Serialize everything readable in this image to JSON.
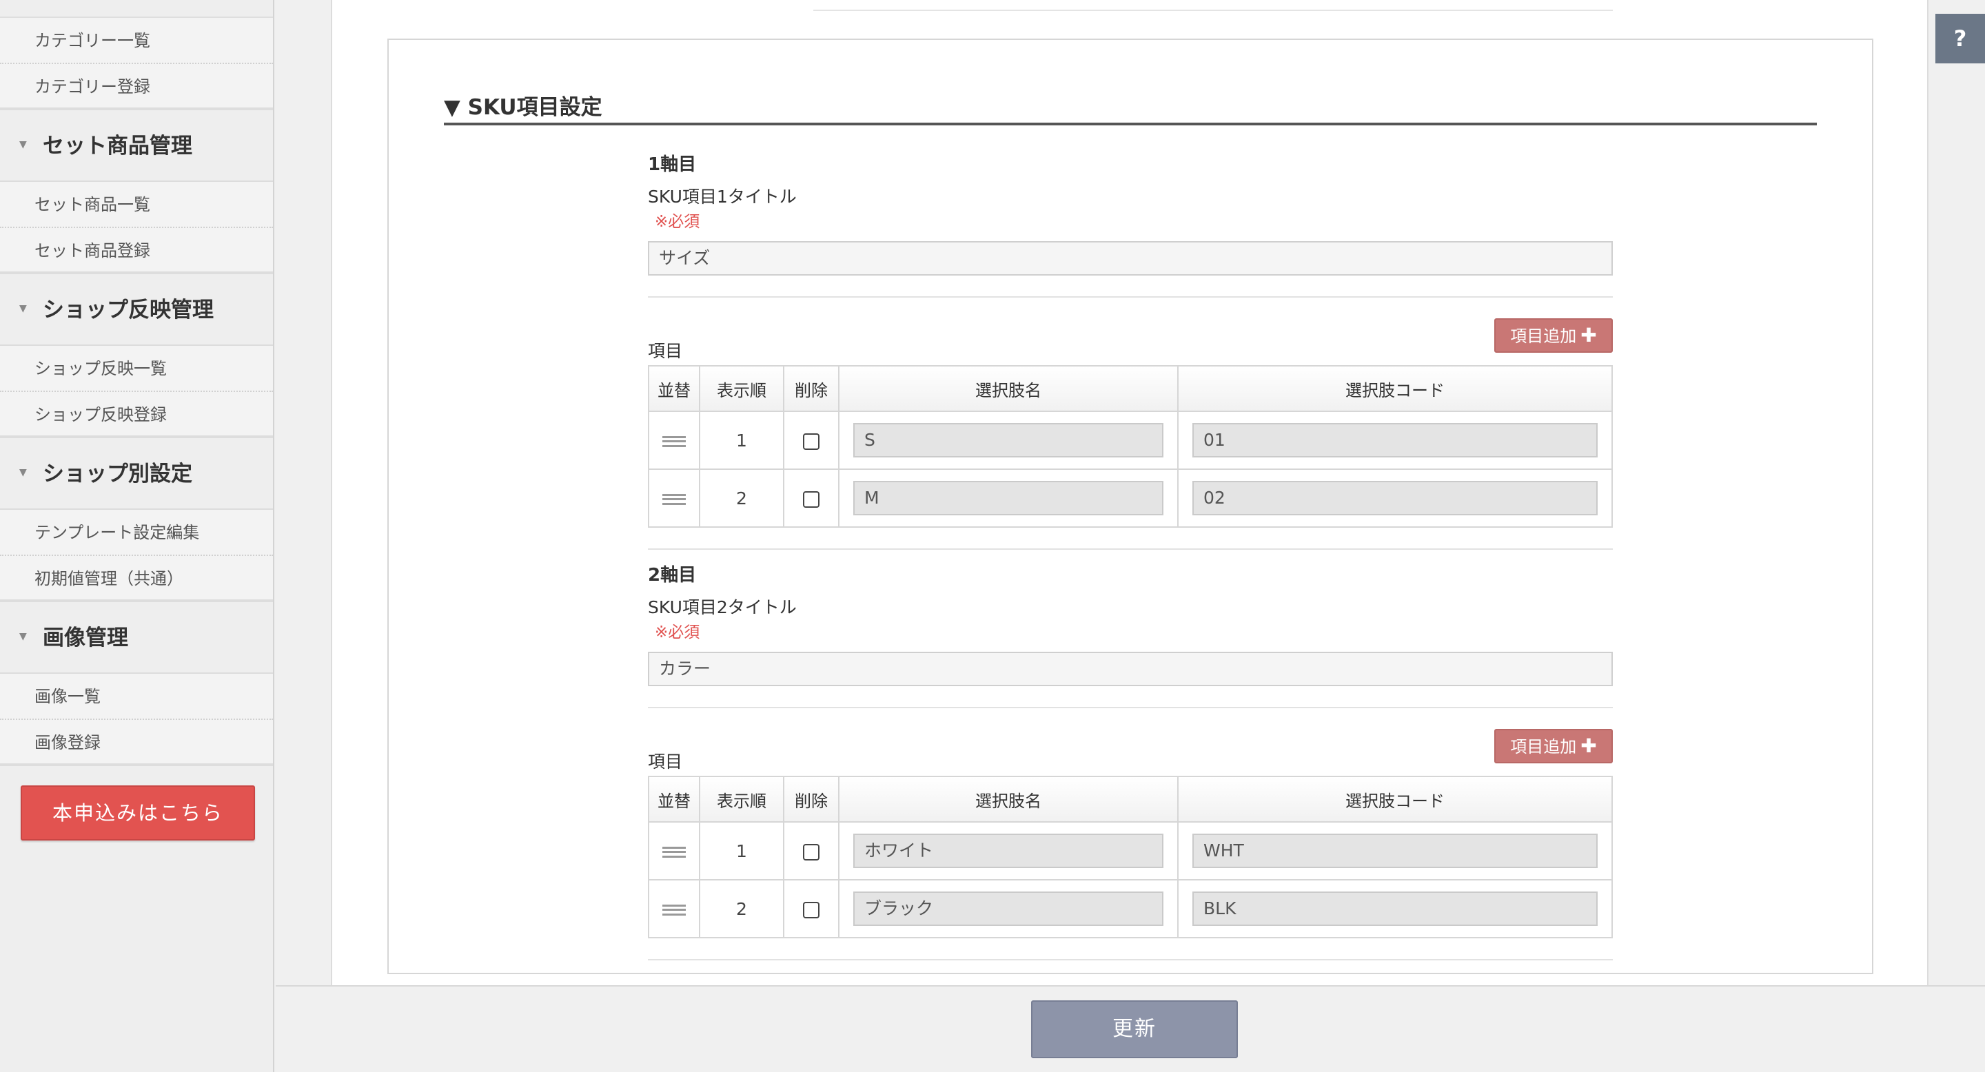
{
  "sidebar": {
    "sections": [
      {
        "title": "",
        "items": [
          "カテゴリー一覧",
          "カテゴリー登録"
        ]
      },
      {
        "title": "セット商品管理",
        "items": [
          "セット商品一覧",
          "セット商品登録"
        ]
      },
      {
        "title": "ショップ反映管理",
        "items": [
          "ショップ反映一覧",
          "ショップ反映登録"
        ]
      },
      {
        "title": "ショップ別設定",
        "items": [
          "テンプレート設定編集",
          "初期値管理（共通）"
        ]
      },
      {
        "title": "画像管理",
        "items": [
          "画像一覧",
          "画像登録"
        ]
      }
    ],
    "apply_button": "本申込みはこちら"
  },
  "section": {
    "title": "▼ SKU項目設定"
  },
  "axes": [
    {
      "heading": "1軸目",
      "title_label": "SKU項目1タイトル",
      "required": "※必須",
      "title_value": "サイズ",
      "items_label": "項目",
      "add_button": "項目追加",
      "columns": [
        "並替",
        "表示順",
        "削除",
        "選択肢名",
        "選択肢コード"
      ],
      "rows": [
        {
          "order": "1",
          "name": "S",
          "code": "01"
        },
        {
          "order": "2",
          "name": "M",
          "code": "02"
        }
      ]
    },
    {
      "heading": "2軸目",
      "title_label": "SKU項目2タイトル",
      "required": "※必須",
      "title_value": "カラー",
      "items_label": "項目",
      "add_button": "項目追加",
      "columns": [
        "並替",
        "表示順",
        "削除",
        "選択肢名",
        "選択肢コード"
      ],
      "rows": [
        {
          "order": "1",
          "name": "ホワイト",
          "code": "WHT"
        },
        {
          "order": "2",
          "name": "ブラック",
          "code": "BLK"
        }
      ]
    }
  ],
  "footer": {
    "update_button": "更新"
  },
  "help": {
    "label": "?"
  },
  "colors": {
    "apply_button": "#e25350",
    "add_button": "#c97775",
    "update_button": "#8d94a9",
    "required_text": "#e0514f",
    "help_button": "#6b7787"
  }
}
